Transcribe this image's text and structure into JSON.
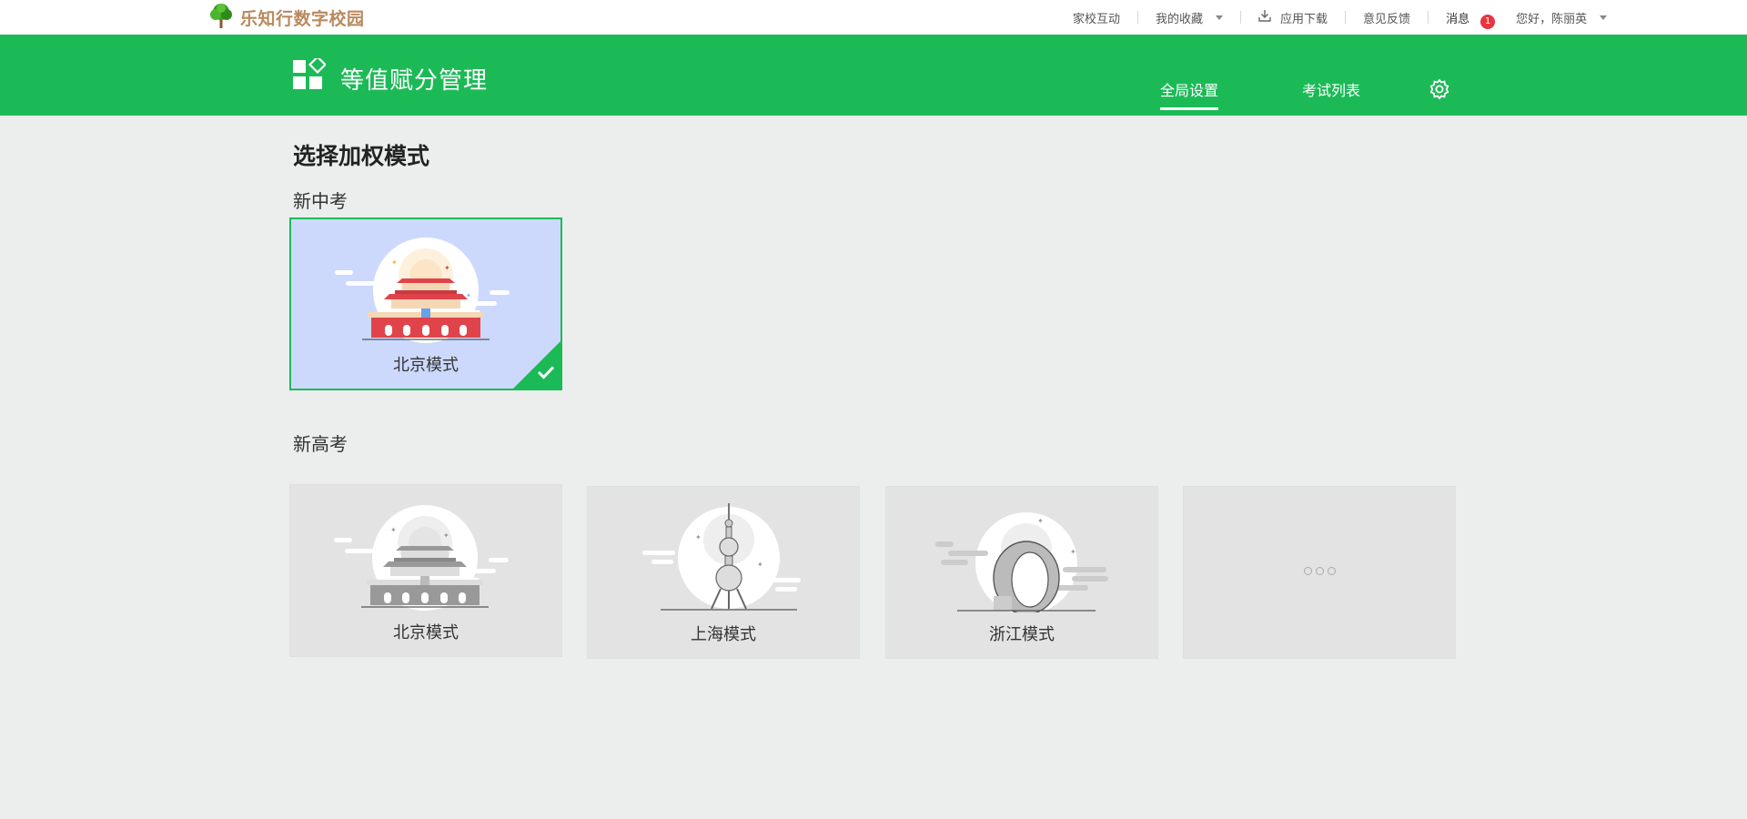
{
  "brand": {
    "name": "乐知行数字校园"
  },
  "topnav": {
    "home_school": "家校互动",
    "favorites": "我的收藏",
    "app_download": "应用下载",
    "feedback": "意见反馈",
    "messages": "消息",
    "message_count": "1",
    "greeting": "您好，陈丽英"
  },
  "header": {
    "title": "等值赋分管理",
    "tabs": [
      {
        "label": "全局设置",
        "active": true
      },
      {
        "label": "考试列表",
        "active": false
      }
    ]
  },
  "main": {
    "page_title": "选择加权模式",
    "sections": [
      {
        "title": "新中考",
        "cards": [
          {
            "label": "北京模式",
            "selected": true,
            "illustration": "tiananmen-color"
          }
        ]
      },
      {
        "title": "新高考",
        "cards": [
          {
            "label": "北京模式",
            "selected": false,
            "illustration": "tiananmen-gray"
          },
          {
            "label": "上海模式",
            "selected": false,
            "illustration": "oriental-pearl-tower"
          },
          {
            "label": "浙江模式",
            "selected": false,
            "illustration": "sheraton-ring"
          },
          {
            "label": "",
            "selected": false,
            "illustration": "more-dots-icon"
          }
        ]
      }
    ]
  },
  "colors": {
    "accent_green": "#1cba57",
    "selected_card_bg": "#cdd9fc",
    "badge_red": "#e8353e",
    "brand_brown": "#b98a5e"
  }
}
